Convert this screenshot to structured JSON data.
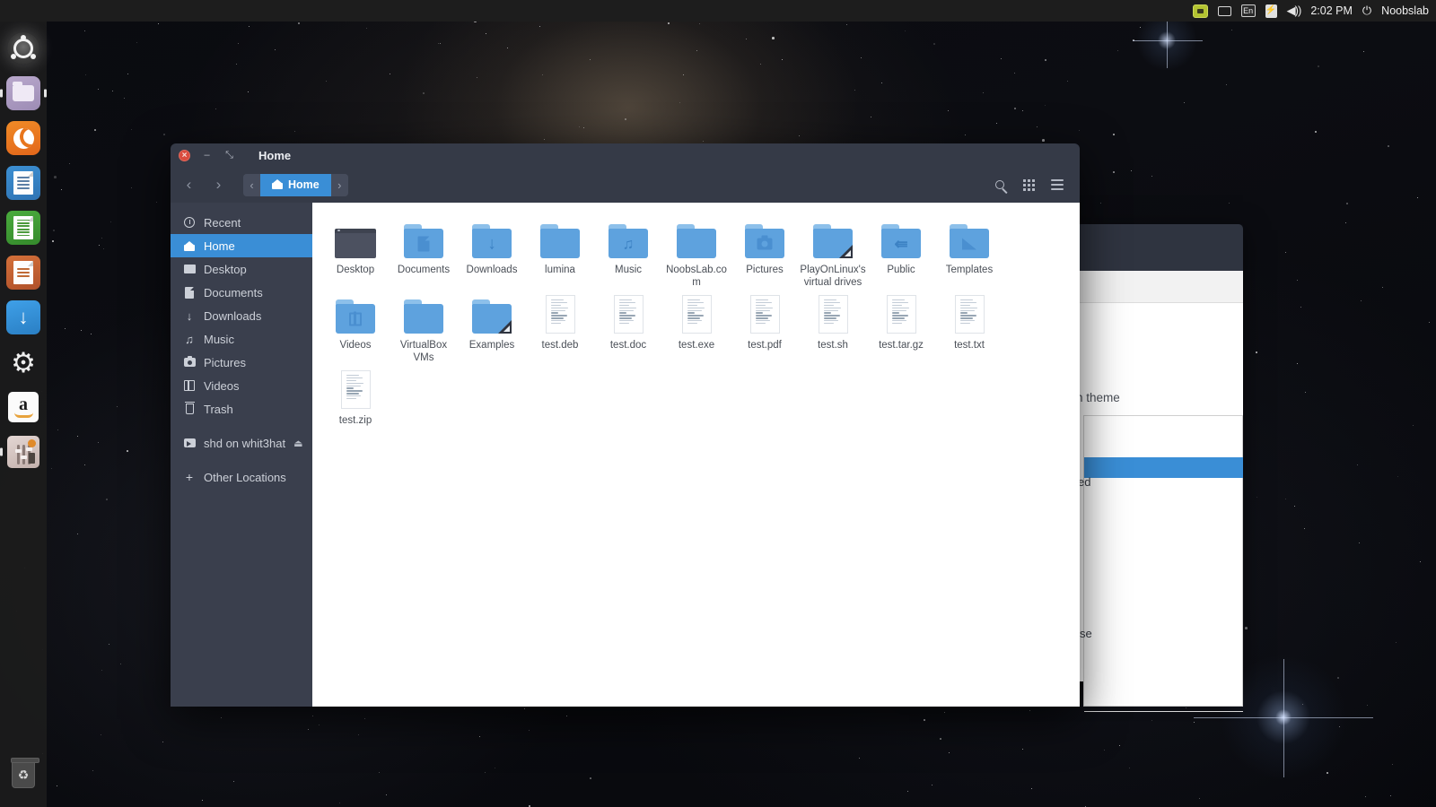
{
  "top_panel": {
    "indicators": [
      {
        "name": "screenshot-indicator",
        "label": ""
      },
      {
        "name": "display-indicator",
        "label": ""
      },
      {
        "name": "keyboard-layout-indicator",
        "label": "En"
      },
      {
        "name": "battery-indicator",
        "label": ""
      },
      {
        "name": "volume-indicator",
        "label": ""
      }
    ],
    "keyboard_layout": "En",
    "volume_glyph": "◀))",
    "clock": "2:02 PM",
    "power_glyph": "⏻",
    "session_user": "Noobslab"
  },
  "launcher": {
    "items": [
      {
        "name": "ubuntu-dash",
        "label": "Dash"
      },
      {
        "name": "files",
        "label": "Files"
      },
      {
        "name": "firefox",
        "label": "Firefox"
      },
      {
        "name": "libreoffice-writer",
        "label": "LibreOffice Writer"
      },
      {
        "name": "libreoffice-calc",
        "label": "LibreOffice Calc"
      },
      {
        "name": "libreoffice-impress",
        "label": "LibreOffice Impress"
      },
      {
        "name": "software-updater",
        "label": "Software Updater"
      },
      {
        "name": "system-settings",
        "label": "System Settings"
      },
      {
        "name": "amazon",
        "label": "Amazon"
      },
      {
        "name": "audio-mixer",
        "label": "Audio Mixer"
      },
      {
        "name": "trash",
        "label": "Trash"
      }
    ],
    "gear_glyph": "⚙",
    "download_glyph": "↓",
    "trash_glyph": "♻",
    "amazon_letter": "a"
  },
  "file_manager": {
    "title": "Home",
    "window_buttons": {
      "close": "×",
      "minimize": "–",
      "maximize": "⤡"
    },
    "nav": {
      "back": "‹",
      "forward": "›"
    },
    "pathbar": {
      "prev_chevron": "‹",
      "next_chevron": "›",
      "current": "Home"
    },
    "toolbar": {
      "search_label": "Search",
      "view_grid_label": "View options",
      "menu_label": "Menu"
    },
    "sidebar": [
      {
        "name": "sidebar-item-recent",
        "label": "Recent",
        "icon": "clock-icon",
        "active": false
      },
      {
        "name": "sidebar-item-home",
        "label": "Home",
        "icon": "home-icon",
        "active": true
      },
      {
        "name": "sidebar-item-desktop",
        "label": "Desktop",
        "icon": "desktop-icon",
        "active": false
      },
      {
        "name": "sidebar-item-documents",
        "label": "Documents",
        "icon": "document-icon",
        "active": false
      },
      {
        "name": "sidebar-item-downloads",
        "label": "Downloads",
        "icon": "download-icon",
        "active": false
      },
      {
        "name": "sidebar-item-music",
        "label": "Music",
        "icon": "music-icon",
        "active": false
      },
      {
        "name": "sidebar-item-pictures",
        "label": "Pictures",
        "icon": "camera-icon",
        "active": false
      },
      {
        "name": "sidebar-item-videos",
        "label": "Videos",
        "icon": "video-icon",
        "active": false
      },
      {
        "name": "sidebar-item-trash",
        "label": "Trash",
        "icon": "trash-icon",
        "active": false
      },
      {
        "name": "sidebar-item-shd",
        "label": "shd on whit3hat",
        "icon": "drive-icon",
        "active": false,
        "eject": "⏏"
      },
      {
        "name": "sidebar-item-other",
        "label": "Other Locations",
        "icon": "plus-icon",
        "active": false
      }
    ],
    "files": [
      {
        "name": "Desktop",
        "type": "monitor"
      },
      {
        "name": "Documents",
        "type": "folder",
        "emblem": "document"
      },
      {
        "name": "Downloads",
        "type": "folder",
        "emblem": "download"
      },
      {
        "name": "lumina",
        "type": "folder",
        "emblem": "none"
      },
      {
        "name": "Music",
        "type": "folder",
        "emblem": "music"
      },
      {
        "name": "NoobsLab.com",
        "type": "folder",
        "emblem": "none"
      },
      {
        "name": "Pictures",
        "type": "folder",
        "emblem": "camera"
      },
      {
        "name": "PlayOnLinux's virtual drives",
        "type": "folder",
        "emblem": "none",
        "corner": true
      },
      {
        "name": "Public",
        "type": "folder",
        "emblem": "share"
      },
      {
        "name": "Templates",
        "type": "folder",
        "emblem": "template"
      },
      {
        "name": "Videos",
        "type": "folder",
        "emblem": "video"
      },
      {
        "name": "VirtualBox VMs",
        "type": "folder",
        "emblem": "none"
      },
      {
        "name": "Examples",
        "type": "folder",
        "emblem": "none",
        "corner": true
      },
      {
        "name": "test.deb",
        "type": "document"
      },
      {
        "name": "test.doc",
        "type": "document"
      },
      {
        "name": "test.exe",
        "type": "document"
      },
      {
        "name": "test.pdf",
        "type": "document"
      },
      {
        "name": "test.sh",
        "type": "document"
      },
      {
        "name": "test.tar.gz",
        "type": "document"
      },
      {
        "name": "test.txt",
        "type": "document"
      },
      {
        "name": "test.zip",
        "type": "document"
      }
    ]
  },
  "background_window": {
    "visible_label": "n theme",
    "visible_row_text": "ed",
    "visible_row_text2": "se"
  },
  "colors": {
    "accent_blue": "#3a8ed6",
    "titlebar": "#353a47",
    "sidebar": "#3a3f4d",
    "folder_blue": "#5ea2de",
    "panel_dark": "#1d1d1d",
    "close_red": "#d94b3e"
  }
}
